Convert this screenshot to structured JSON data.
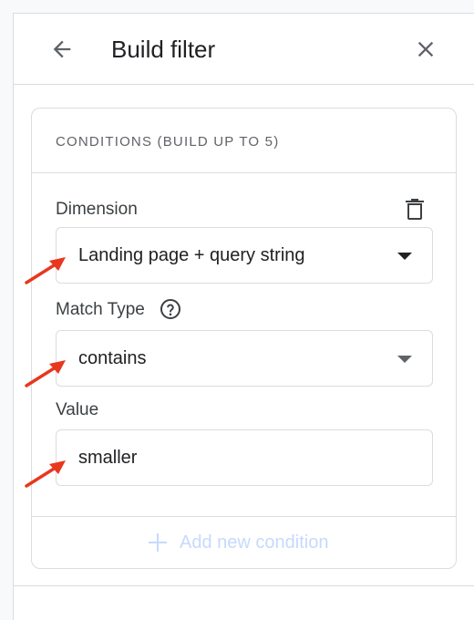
{
  "header": {
    "title": "Build filter",
    "back_icon": "arrow-left-icon",
    "close_icon": "close-icon"
  },
  "conditions": {
    "heading": "CONDITIONS (BUILD UP TO 5)",
    "dimension": {
      "label": "Dimension",
      "value": "Landing page + query string",
      "delete_icon": "trash-icon"
    },
    "match_type": {
      "label": "Match Type",
      "value": "contains",
      "help_icon": "help-circle-icon"
    },
    "value_field": {
      "label": "Value",
      "value": "smaller"
    },
    "add_condition": {
      "label": "Add new condition",
      "icon": "plus-icon"
    }
  },
  "annotations": {
    "arrow_color": "#e8371e"
  },
  "colors": {
    "text": "#202124",
    "secondary_text": "#5f6368",
    "border": "#dadce0",
    "disabled_link": "#c6dafc",
    "background": "#f8f9fa"
  }
}
